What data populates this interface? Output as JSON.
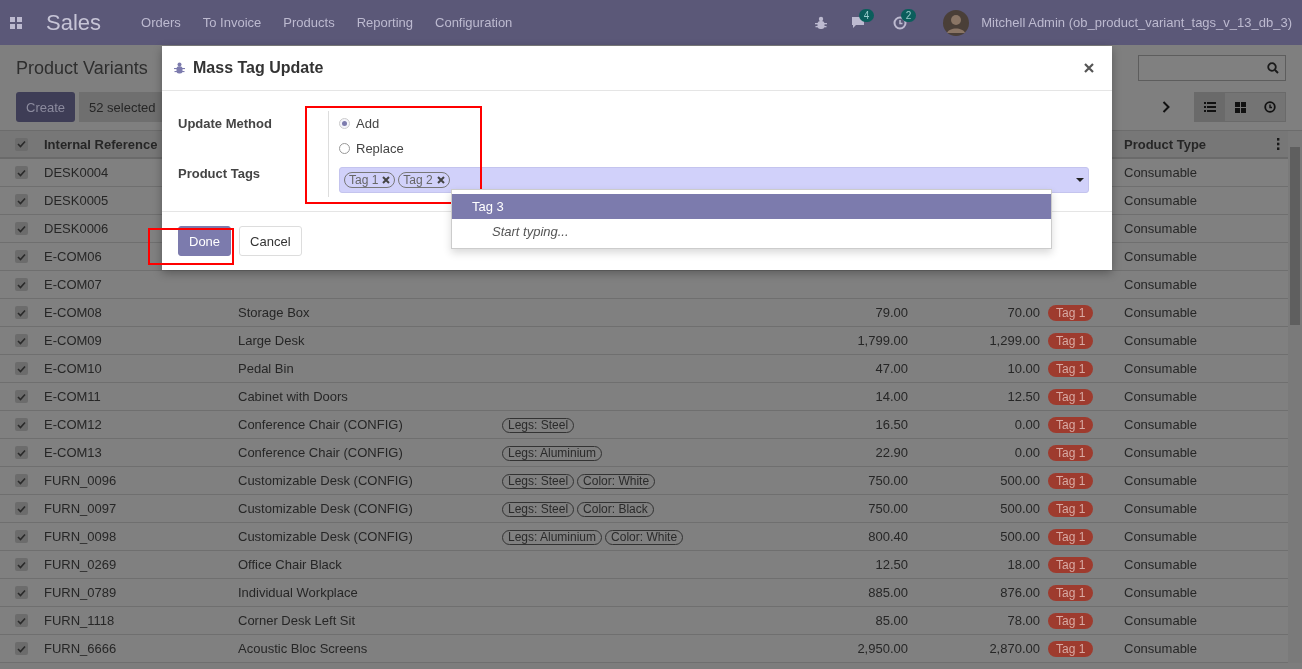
{
  "nav": {
    "app_name": "Sales",
    "menu": [
      "Orders",
      "To Invoice",
      "Products",
      "Reporting",
      "Configuration"
    ],
    "messages_count": "4",
    "activities_count": "2",
    "user": "Mitchell Admin (ob_product_variant_tags_v_13_db_3)"
  },
  "control_panel": {
    "title": "Product Variants",
    "create_button": "Create",
    "selection": "52 selected"
  },
  "table": {
    "header_checked": true,
    "internal_reference_header": "Internal Reference",
    "product_type_header": "Product Type",
    "rows": [
      {
        "checked": true,
        "internal_reference": "DESK0004",
        "product_type": "Consumable"
      },
      {
        "checked": true,
        "internal_reference": "DESK0005",
        "product_type": "Consumable"
      },
      {
        "checked": true,
        "internal_reference": "DESK0006",
        "product_type": "Consumable"
      },
      {
        "checked": true,
        "internal_reference": "E-COM06",
        "product_type": "Consumable"
      },
      {
        "checked": true,
        "internal_reference": "E-COM07",
        "product_type": "Consumable"
      },
      {
        "checked": true,
        "internal_reference": "E-COM08",
        "column_2": "Storage Box",
        "column_4": "79.00",
        "column_5": "70.00",
        "column_6": [
          "Tag 1"
        ],
        "product_type": "Consumable"
      },
      {
        "checked": true,
        "internal_reference": "E-COM09",
        "column_2": "Large Desk",
        "column_4": "1,799.00",
        "column_5": "1,299.00",
        "column_6": [
          "Tag 1"
        ],
        "product_type": "Consumable"
      },
      {
        "checked": true,
        "internal_reference": "E-COM10",
        "column_2": "Pedal Bin",
        "column_4": "47.00",
        "column_5": "10.00",
        "column_6": [
          "Tag 1"
        ],
        "product_type": "Consumable"
      },
      {
        "checked": true,
        "internal_reference": "E-COM11",
        "column_2": "Cabinet with Doors",
        "column_4": "14.00",
        "column_5": "12.50",
        "column_6": [
          "Tag 1"
        ],
        "product_type": "Consumable"
      },
      {
        "checked": true,
        "internal_reference": "E-COM12",
        "column_2": "Conference Chair (CONFIG)",
        "column_3": [
          "Legs: Steel"
        ],
        "column_4": "16.50",
        "column_5": "0.00",
        "column_6": [
          "Tag 1"
        ],
        "product_type": "Consumable"
      },
      {
        "checked": true,
        "internal_reference": "E-COM13",
        "column_2": "Conference Chair (CONFIG)",
        "column_3": [
          "Legs: Aluminium"
        ],
        "column_4": "22.90",
        "column_5": "0.00",
        "column_6": [
          "Tag 1"
        ],
        "product_type": "Consumable"
      },
      {
        "checked": true,
        "internal_reference": "FURN_0096",
        "column_2": "Customizable Desk (CONFIG)",
        "column_3": [
          "Legs: Steel",
          "Color: White"
        ],
        "column_4": "750.00",
        "column_5": "500.00",
        "column_6": [
          "Tag 1"
        ],
        "product_type": "Consumable"
      },
      {
        "checked": true,
        "internal_reference": "FURN_0097",
        "column_2": "Customizable Desk (CONFIG)",
        "column_3": [
          "Legs: Steel",
          "Color: Black"
        ],
        "column_4": "750.00",
        "column_5": "500.00",
        "column_6": [
          "Tag 1"
        ],
        "product_type": "Consumable"
      },
      {
        "checked": true,
        "internal_reference": "FURN_0098",
        "column_2": "Customizable Desk (CONFIG)",
        "column_3": [
          "Legs: Aluminium",
          "Color: White"
        ],
        "column_4": "800.40",
        "column_5": "500.00",
        "column_6": [
          "Tag 1"
        ],
        "product_type": "Consumable"
      },
      {
        "checked": true,
        "internal_reference": "FURN_0269",
        "column_2": "Office Chair Black",
        "column_4": "12.50",
        "column_5": "18.00",
        "column_6": [
          "Tag 1"
        ],
        "product_type": "Consumable"
      },
      {
        "checked": true,
        "internal_reference": "FURN_0789",
        "column_2": "Individual Workplace",
        "column_4": "885.00",
        "column_5": "876.00",
        "column_6": [
          "Tag 1"
        ],
        "product_type": "Consumable"
      },
      {
        "checked": true,
        "internal_reference": "FURN_1118",
        "column_2": "Corner Desk Left Sit",
        "column_4": "85.00",
        "column_5": "78.00",
        "column_6": [
          "Tag 1"
        ],
        "product_type": "Consumable"
      },
      {
        "checked": true,
        "internal_reference": "FURN_6666",
        "column_2": "Acoustic Bloc Screens",
        "column_4": "2,950.00",
        "column_5": "2,870.00",
        "column_6": [
          "Tag 1"
        ],
        "product_type": "Consumable"
      }
    ]
  },
  "dialog": {
    "title": "Mass Tag Update",
    "fields": [
      {
        "label": "Update Method",
        "kind": "radio",
        "options": [
          {
            "label": "Add",
            "selected": true
          },
          {
            "label": "Replace",
            "selected": false
          }
        ]
      },
      {
        "label": "Product Tags",
        "kind": "tags",
        "tags": [
          "Tag 1",
          "Tag 2"
        ],
        "dropdown": [
          {
            "label": "Tag 3",
            "kind": "option",
            "selected": true
          },
          {
            "label": "Start typing...",
            "kind": "hint",
            "selected": false
          }
        ]
      }
    ],
    "buttons": [
      {
        "label": "Done",
        "kind": "primary"
      },
      {
        "label": "Cancel",
        "kind": "secondary"
      }
    ]
  }
}
